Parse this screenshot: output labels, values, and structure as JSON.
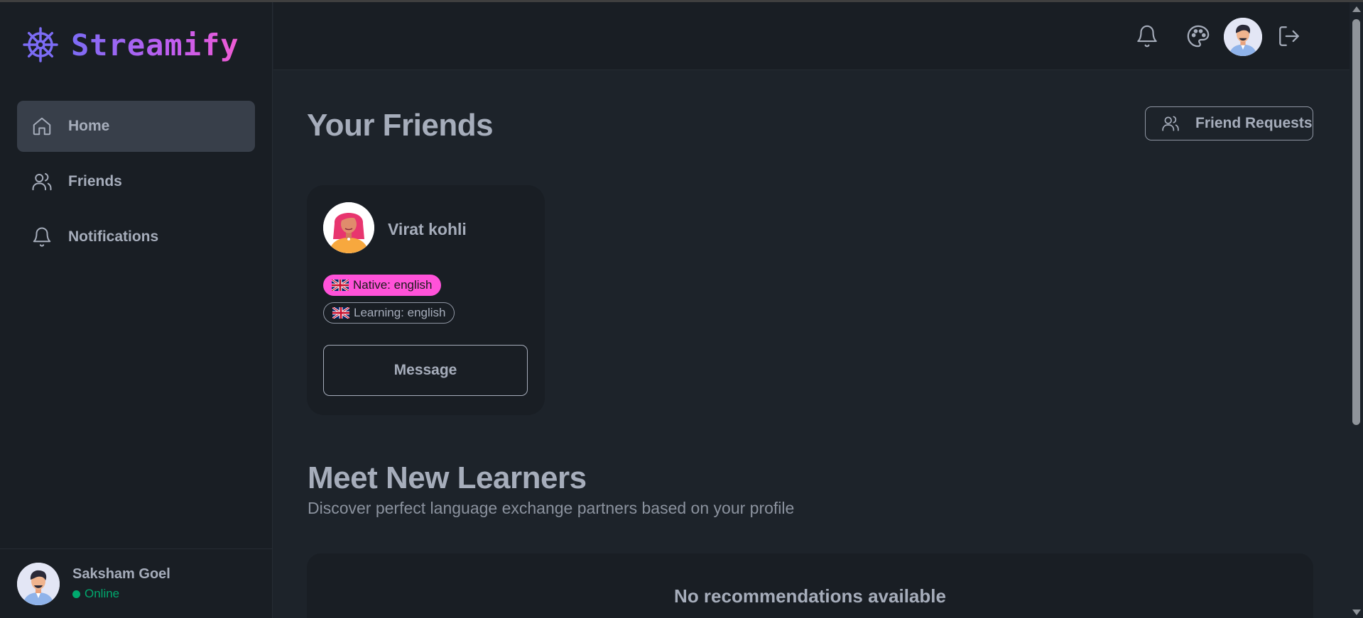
{
  "app": {
    "name": "Streamify"
  },
  "nav": {
    "items": [
      {
        "label": "Home",
        "icon": "home-icon",
        "active": true
      },
      {
        "label": "Friends",
        "icon": "users-icon",
        "active": false
      },
      {
        "label": "Notifications",
        "icon": "bell-icon",
        "active": false
      }
    ]
  },
  "user": {
    "name": "Saksham Goel",
    "status": "Online"
  },
  "header": {
    "icons": [
      "bell-icon",
      "palette-icon",
      "avatar",
      "logout-icon"
    ]
  },
  "friends_section": {
    "title": "Your Friends",
    "requests_button": "Friend Requests"
  },
  "friend_card": {
    "name": "Virat kohli",
    "native": "Native: english",
    "learning": "Learning: english",
    "message_button": "Message"
  },
  "learners_section": {
    "title": "Meet New Learners",
    "subtitle": "Discover perfect language exchange partners based on your profile",
    "empty_text": "No recommendations available"
  },
  "colors": {
    "background": "#1d232a",
    "surface": "#191e24",
    "active_nav": "#383f4a",
    "text": "#a6adbb",
    "accent_pink": "#ff52d9",
    "online_green": "#00a96e",
    "logo_gradient_start": "#7c6cf5",
    "logo_gradient_end": "#f05bd3"
  }
}
